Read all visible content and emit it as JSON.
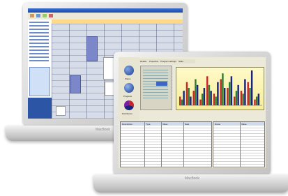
{
  "back_laptop": {
    "brand": "MacBook"
  },
  "front_laptop": {
    "brand": "MacBook",
    "tabs": [
      "Details",
      "Projection",
      "Program settings",
      "Stats"
    ],
    "dash_labels": [
      "Status",
      "Progress",
      "Distribution"
    ],
    "table_header": [
      "Description",
      "Type",
      "Value",
      "Date"
    ],
    "side_panel_header": [
      "Name",
      "Value"
    ]
  },
  "chart_data": {
    "type": "bar",
    "title": "",
    "series": [
      {
        "values": [
          3,
          8,
          5,
          2,
          10,
          4,
          9,
          6,
          3,
          5,
          8,
          2
        ]
      },
      {
        "values": [
          2,
          6,
          9,
          4,
          7,
          3,
          11,
          8,
          5,
          4,
          6,
          3
        ]
      },
      {
        "values": [
          5,
          3,
          7,
          6,
          5,
          8,
          6,
          10,
          7,
          9,
          12,
          4
        ]
      }
    ],
    "colors": [
      "#c62828",
      "#2e7d32",
      "#1a237e"
    ],
    "ylim": [
      0,
      12
    ]
  }
}
